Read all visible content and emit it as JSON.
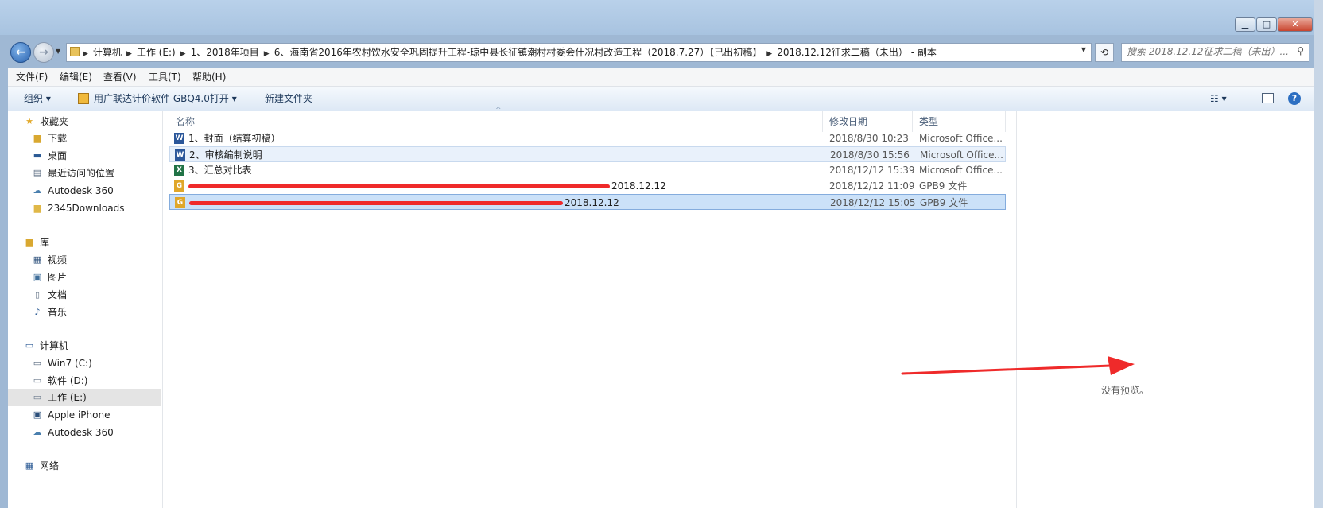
{
  "addressbar": {
    "crumbs": [
      "计算机",
      "工作 (E:)",
      "1、2018年项目",
      "6、海南省2016年农村饮水安全巩固提升工程-琼中县长征镇潮村村委会什况村改造工程（2018.7.27）【已出初稿】",
      "2018.12.12征求二稿（未出） - 副本"
    ],
    "search_placeholder": "搜索 2018.12.12征求二稿（未出）..."
  },
  "menubar": {
    "items": [
      "文件(F)",
      "编辑(E)",
      "查看(V)",
      "工具(T)",
      "帮助(H)"
    ]
  },
  "toolbar": {
    "organize": "组织 ▾",
    "open_with": "用广联达计价软件 GBQ4.0打开 ▾",
    "new_folder": "新建文件夹"
  },
  "sidebar": {
    "favorites_label": "收藏夹",
    "favorites": [
      "下载",
      "桌面",
      "最近访问的位置",
      "Autodesk 360",
      "2345Downloads"
    ],
    "libraries_label": "库",
    "libraries": [
      "视频",
      "图片",
      "文档",
      "音乐"
    ],
    "computer_label": "计算机",
    "drives": [
      "Win7 (C:)",
      "软件 (D:)",
      "工作 (E:)",
      "Apple iPhone",
      "Autodesk 360"
    ],
    "network_label": "网络"
  },
  "columns": {
    "name": "名称",
    "date": "修改日期",
    "type": "类型"
  },
  "files": [
    {
      "name": "1、封面（结算初稿）",
      "date": "2018/8/30 10:23",
      "type": "Microsoft Office...",
      "icon": "word-doc-icon"
    },
    {
      "name": "2、审核编制说明",
      "date": "2018/8/30 15:56",
      "type": "Microsoft Office...",
      "icon": "word-doc-icon"
    },
    {
      "name": "3、汇总对比表",
      "date": "2018/12/12 15:39",
      "type": "Microsoft Office...",
      "icon": "excel-doc-icon"
    },
    {
      "name": "2018.12.12",
      "date": "2018/12/12 11:09",
      "type": "GPB9 文件",
      "icon": "gpb9-file-icon"
    },
    {
      "name": "2018.12.12",
      "date": "2018/12/12 15:05",
      "type": "GPB9 文件",
      "icon": "gpb9-file-icon"
    }
  ],
  "preview": {
    "text": "没有预览。"
  },
  "colors": {
    "selection": "#cbe1f8",
    "annotation_red": "#ef2a2a"
  }
}
